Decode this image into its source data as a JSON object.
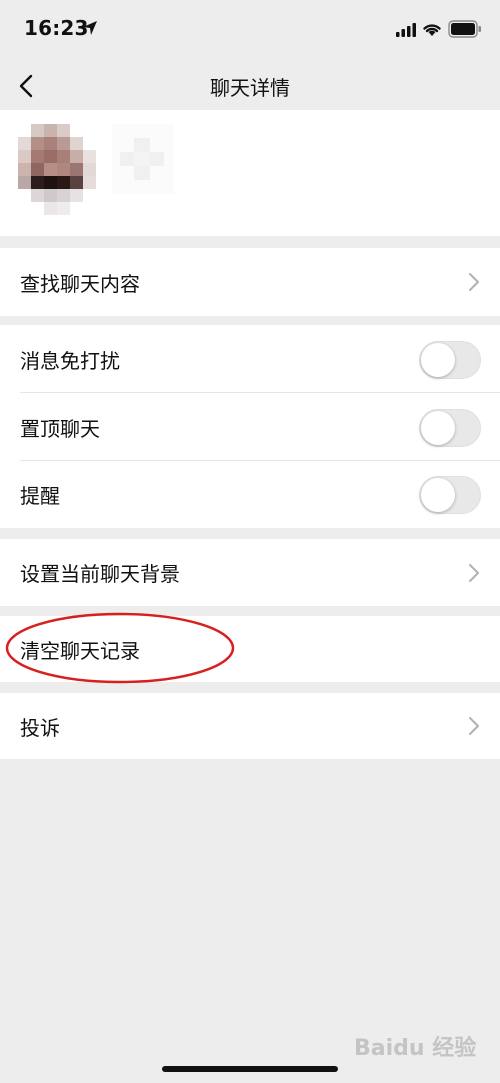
{
  "status_bar": {
    "time": "16:23",
    "icons": [
      "location-arrow-icon",
      "signal-icon",
      "wifi-icon",
      "battery-icon"
    ]
  },
  "nav": {
    "title": "聊天详情",
    "back_icon": "chevron-left-icon"
  },
  "groups": {
    "search": {
      "label": "查找聊天内容"
    },
    "settings": {
      "items": [
        {
          "label": "消息免打扰",
          "toggle_on": false
        },
        {
          "label": "置顶聊天",
          "toggle_on": false
        },
        {
          "label": "提醒",
          "toggle_on": false
        }
      ]
    },
    "background": {
      "label": "设置当前聊天背景"
    },
    "clear": {
      "label": "清空聊天记录"
    },
    "report": {
      "label": "投诉"
    }
  },
  "watermark": "Baidu 经验",
  "colors": {
    "page_bg": "#ededed",
    "cell_bg": "#ffffff",
    "annotation": "#d81e1e",
    "toggle_off": "#e8e8e8"
  }
}
